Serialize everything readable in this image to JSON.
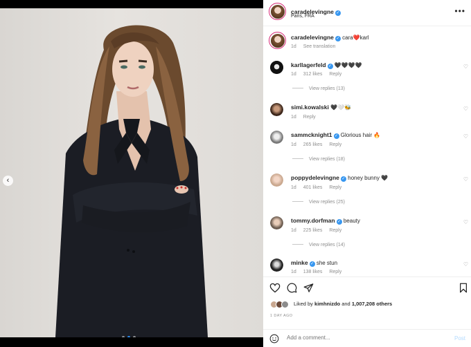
{
  "post": {
    "username": "caradelevingne",
    "location": "Paris, FRA",
    "caption": "cara❤️karl",
    "caption_time": "1d",
    "see_translation": "See translation"
  },
  "comments": [
    {
      "username": "karllagerfeld",
      "text": "🖤🖤🖤🖤",
      "time": "1d",
      "likes": "312 likes",
      "reply": "Reply",
      "view_replies": "View replies (13)"
    },
    {
      "username": "simi.kowalski",
      "text": "🖤🤍🐝",
      "time": "1d",
      "likes": "",
      "reply": "Reply",
      "view_replies": ""
    },
    {
      "username": "sammcknight1",
      "text": "Glorious hair 🔥",
      "time": "1d",
      "likes": "265 likes",
      "reply": "Reply",
      "view_replies": "View replies (18)"
    },
    {
      "username": "poppydelevingne",
      "text": "honey bunny 🖤",
      "time": "1d",
      "likes": "401 likes",
      "reply": "Reply",
      "view_replies": "View replies (25)"
    },
    {
      "username": "tommy.dorfman",
      "text": "beauty",
      "time": "1d",
      "likes": "225 likes",
      "reply": "Reply",
      "view_replies": "View replies (14)"
    },
    {
      "username": "minke",
      "text": "she stun",
      "time": "1d",
      "likes": "138 likes",
      "reply": "Reply",
      "view_replies": ""
    }
  ],
  "footer": {
    "liked_by_prefix": "Liked by",
    "liked_by_user": "kimhnizdo",
    "liked_by_and": "and",
    "liked_by_count": "1,007,208 others",
    "time_ago": "1 DAY AGO",
    "add_comment_placeholder": "Add a comment...",
    "post_label": "Post"
  },
  "colors": {
    "verified": "#3897f0",
    "active_dot": "#2a8cf0",
    "post_disabled": "#b3dbff"
  },
  "carousel": {
    "count": 3,
    "active": 2
  }
}
